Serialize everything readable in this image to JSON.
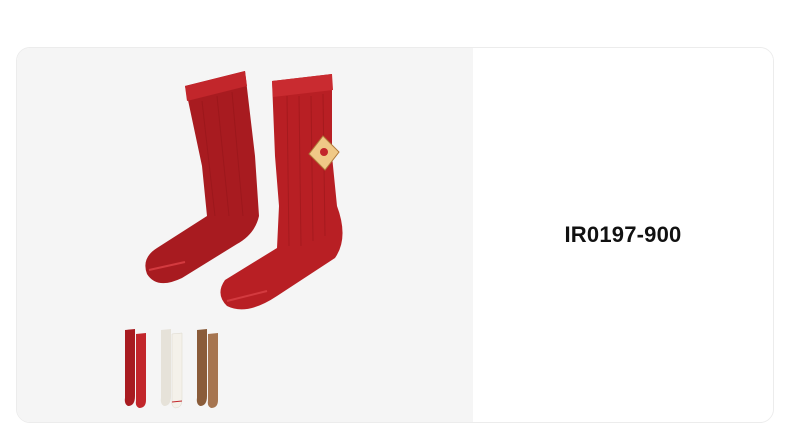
{
  "product": {
    "sku": "IR0197-900",
    "image_icon": "red-crew-socks-pair-image",
    "color_variants": [
      {
        "name": "red",
        "color": "#b81f24",
        "icon": "red-socks-thumbnail"
      },
      {
        "name": "white",
        "color": "#f2efe8",
        "icon": "white-socks-thumbnail"
      },
      {
        "name": "brown",
        "color": "#9a6b45",
        "icon": "brown-socks-thumbnail"
      }
    ]
  },
  "colors": {
    "image_background": "#f5f5f5",
    "sock_red": "#b81f24",
    "sock_red_dark": "#8f1418",
    "patch": "#f0c987"
  }
}
